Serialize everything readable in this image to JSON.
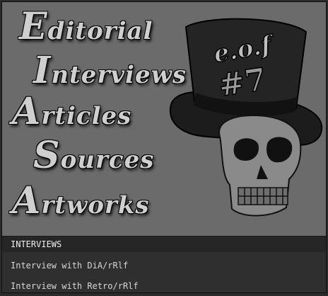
{
  "menu": {
    "items": [
      {
        "cap": "E",
        "rest": "ditorial"
      },
      {
        "cap": "I",
        "rest": "nterviews"
      },
      {
        "cap": "A",
        "rest": "rticles"
      },
      {
        "cap": "S",
        "rest": "ources"
      },
      {
        "cap": "A",
        "rest": "rtworks"
      }
    ]
  },
  "hat": {
    "band_text": "e.o.f",
    "issue_text": "#7"
  },
  "section": {
    "heading": "INTERVIEWS",
    "links": [
      "Interview with DiA/rRlf",
      "Interview with Retro/rRlf"
    ]
  },
  "colors": {
    "hero_bg": "#6b6b6b",
    "content_bg": "#2f2f2f",
    "heading_bg": "#262626"
  }
}
